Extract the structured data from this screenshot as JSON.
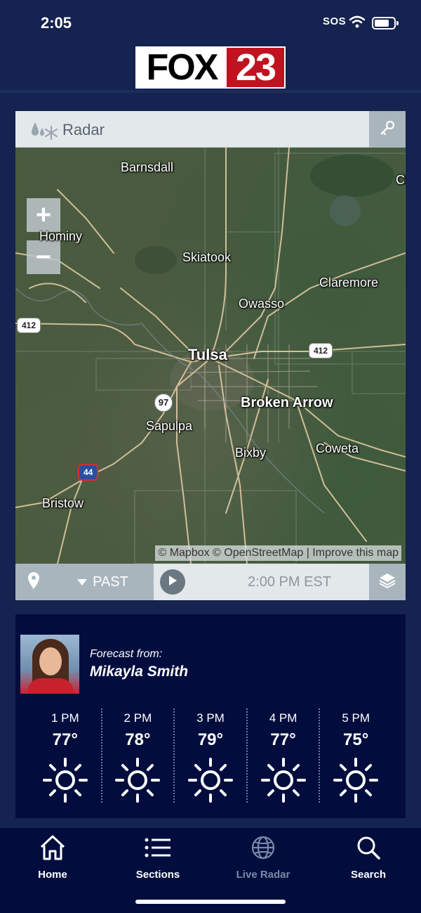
{
  "status_bar": {
    "time": "2:05",
    "sos": "SOS"
  },
  "header": {
    "logo_text_1": "FOX",
    "logo_text_2": "23"
  },
  "radar": {
    "title": "Radar",
    "cities": {
      "barnsdall": "Barnsdall",
      "hominy": "Hominy",
      "skiatook": "Skiatook",
      "claremore": "Claremore",
      "owasso": "Owasso",
      "tulsa": "Tulsa",
      "broken_arrow": "Broken Arrow",
      "sapulpa": "Sapulpa",
      "bixby": "Bixby",
      "coweta": "Coweta",
      "bristow": "Bristow",
      "partial_right": "Cl"
    },
    "shields": {
      "us412_west": "412",
      "us412_east": "412",
      "ok97": "97",
      "i44": "44"
    },
    "attribution": "© Mapbox © OpenStreetMap | Improve this map",
    "timeline": {
      "mode": "PAST",
      "time": "2:00 PM EST"
    }
  },
  "forecast": {
    "label": "Forecast from:",
    "name": "Mikayla Smith",
    "hours": [
      {
        "time": "1 PM",
        "temp": "77°",
        "icon": "sun-icon"
      },
      {
        "time": "2 PM",
        "temp": "78°",
        "icon": "sun-icon"
      },
      {
        "time": "3 PM",
        "temp": "79°",
        "icon": "sun-icon"
      },
      {
        "time": "4 PM",
        "temp": "77°",
        "icon": "sun-icon"
      },
      {
        "time": "5 PM",
        "temp": "75°",
        "icon": "sun-icon"
      }
    ]
  },
  "tabbar": {
    "home": "Home",
    "sections": "Sections",
    "live_radar": "Live Radar",
    "search": "Search"
  },
  "colors": {
    "background": "#14234f",
    "panel": "#020d3e",
    "brand_red": "#c1121f",
    "inactive_tab": "#7d88a8"
  }
}
